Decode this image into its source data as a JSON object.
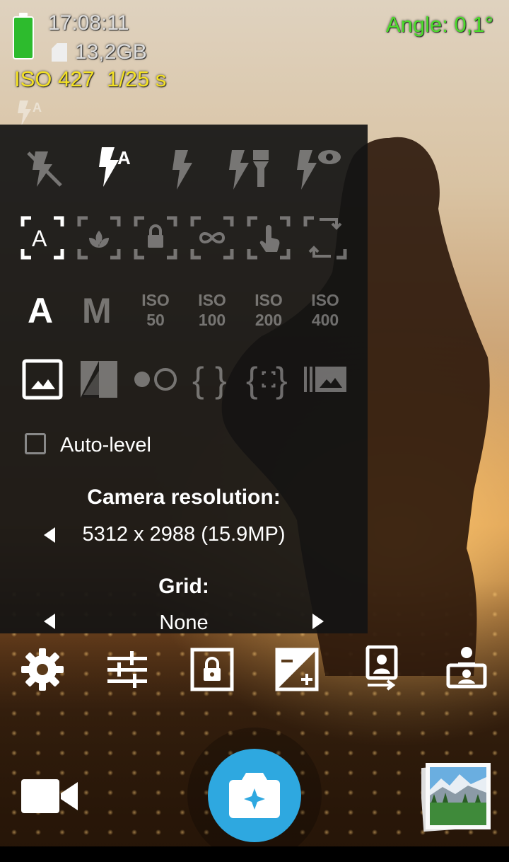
{
  "status": {
    "time": "17:08:11",
    "storage": "13,2GB",
    "iso": "ISO 427",
    "shutter": "1/25 s",
    "angle": "Angle: 0,1°",
    "battery_color": "#2dbb2d",
    "angle_color": "#4cdc2b",
    "iso_color": "#f4e125"
  },
  "panel": {
    "flash_modes": [
      {
        "icon": "flash-off-icon",
        "selected": false
      },
      {
        "icon": "flash-auto-icon",
        "selected": true
      },
      {
        "icon": "flash-on-icon",
        "selected": false
      },
      {
        "icon": "flash-torch-icon",
        "selected": false
      },
      {
        "icon": "flash-red-eye-icon",
        "selected": false
      }
    ],
    "focus_modes": [
      {
        "icon": "focus-auto-icon",
        "selected": true
      },
      {
        "icon": "focus-macro-icon",
        "selected": false
      },
      {
        "icon": "focus-locked-icon",
        "selected": false
      },
      {
        "icon": "focus-infinity-icon",
        "selected": false
      },
      {
        "icon": "focus-manual-icon",
        "selected": false
      },
      {
        "icon": "focus-continuous-icon",
        "selected": false
      }
    ],
    "iso_modes": {
      "auto_label": "A",
      "manual_label": "M",
      "options": [
        {
          "top": "ISO",
          "bottom": "50"
        },
        {
          "top": "ISO",
          "bottom": "100"
        },
        {
          "top": "ISO",
          "bottom": "200"
        },
        {
          "top": "ISO",
          "bottom": "400"
        }
      ]
    },
    "photo_modes": [
      {
        "icon": "photo-standard-icon",
        "selected": true
      },
      {
        "icon": "photo-dro-icon",
        "selected": false
      },
      {
        "icon": "photo-hdr-icon",
        "selected": false
      },
      {
        "icon": "photo-expo-bracketing-icon",
        "selected": false
      },
      {
        "icon": "photo-focus-bracketing-icon",
        "selected": false
      },
      {
        "icon": "photo-fast-burst-icon",
        "selected": false
      }
    ],
    "auto_level_label": "Auto-level",
    "auto_level_checked": false,
    "resolution_heading": "Camera resolution:",
    "resolution_value": "5312 x 2988 (15.9MP)",
    "grid_heading": "Grid:",
    "grid_value": "None"
  },
  "toolbar": {
    "icons": [
      "settings-icon",
      "popup-adjust-icon",
      "exposure-lock-icon",
      "exposure-compensation-icon",
      "switch-camera-icon",
      "switch-multi-camera-icon"
    ]
  },
  "bottom": {
    "video_icon": "video-camera-icon",
    "shutter_icon": "take-photo-icon",
    "gallery_icon": "gallery-thumbnail-icon",
    "shutter_color": "#2ea8e0"
  }
}
